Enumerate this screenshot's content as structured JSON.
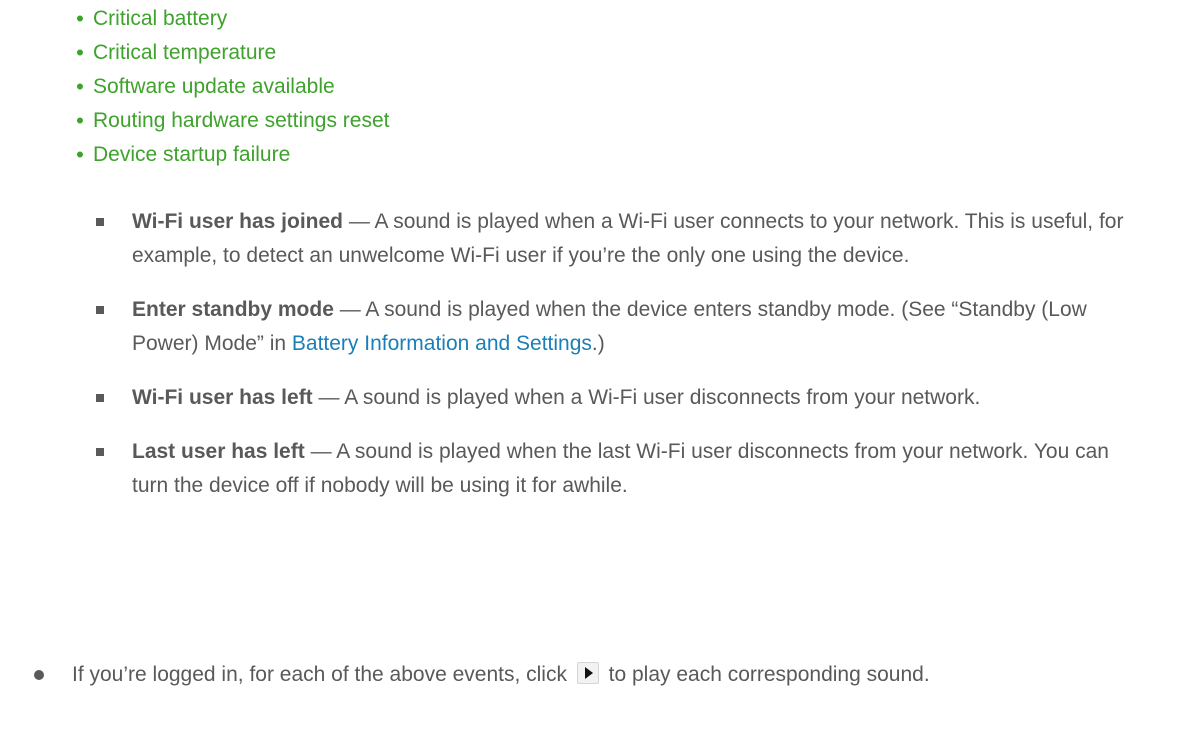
{
  "green_list": [
    {
      "bullet": "•",
      "label": "Critical battery"
    },
    {
      "bullet": "•",
      "label": "Critical temperature"
    },
    {
      "bullet": "•",
      "label": "Software update available"
    },
    {
      "bullet": "•",
      "label": "Routing hardware settings reset"
    },
    {
      "bullet": "•",
      "label": "Device startup failure"
    }
  ],
  "events": [
    {
      "term": "Wi-Fi user has joined",
      "text": " — A sound is played when a Wi-Fi user connects to your network. This is useful, for example, to detect an unwelcome Wi-Fi user if you’re the only one using the device."
    },
    {
      "term": "Enter standby mode",
      "text_before": " — A sound is played when the device enters standby mode. (See “Standby (Low Power) Mode” in ",
      "link": "Battery Information and Settings",
      "text_after": ".)"
    },
    {
      "term": "Wi-Fi user has left",
      "text": " — A sound is played when a Wi-Fi user disconnects from your network."
    },
    {
      "term": "Last user has left",
      "text": " — A sound is played when the last Wi-Fi user disconnects from your network. You can turn the device off if nobody will be using it for awhile."
    }
  ],
  "play_note": {
    "before": "If you’re logged in, for each of the above events, click ",
    "icon": "play-icon",
    "after": " to play each corresponding sound."
  },
  "colors": {
    "green_text": "#3ea22c",
    "body_text": "#595959",
    "link": "#1a7fb5"
  }
}
